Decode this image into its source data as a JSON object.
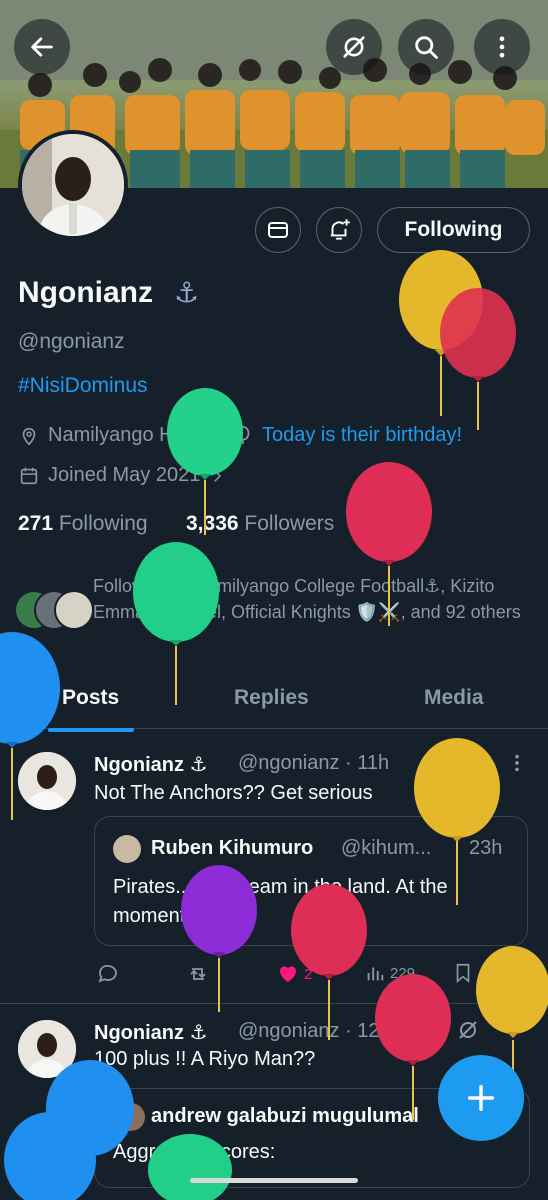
{
  "profile": {
    "name": "Ngonianz",
    "anchor_glyph": "⚓",
    "handle": "@ngonianz",
    "bio_hashtag": "#NisiDominus",
    "location": "Namilyango Hill",
    "birthday": "Today is their birthday!",
    "joined": "Joined May 2021",
    "following_count": "271",
    "following_label": "Following",
    "followers_count": "3,336",
    "followers_label": "Followers",
    "followed_by": "Followed by Namilyango College Football⚓, Kizito Emmanuel Noel, Official Knights 🛡️⚔️, and 92 others"
  },
  "buttons": {
    "follow_state": "Following"
  },
  "tabs": [
    {
      "label": "Posts",
      "active": true
    },
    {
      "label": "Replies",
      "active": false
    },
    {
      "label": "Media",
      "active": false
    }
  ],
  "posts": [
    {
      "author": "Ngonianz ⚓",
      "handle_time": "@ngonianz · 11h",
      "text": "Not The Anchors?? Get serious",
      "quote": {
        "author": "Ruben Kihumuro",
        "handle": "@kihum...",
        "time": "23h",
        "text": "Pirates... Best team in the land. At the moment."
      },
      "likes": "2",
      "views": "229"
    },
    {
      "author": "Ngonianz ⚓",
      "handle_time": "@ngonianz · 12h",
      "text": "100 plus !! A Riyo Man??",
      "quote": {
        "author": "andrew galabuzi mugulumal",
        "text": "Aggregate scores:"
      }
    }
  ],
  "colors": {
    "background": "#15202b",
    "accent": "#1d9bf0",
    "muted": "#8b98a5",
    "like": "#f91880"
  },
  "icons": [
    "back-arrow-icon",
    "grok-icon",
    "search-icon",
    "more-vertical-icon",
    "mail-icon",
    "bell-plus-icon",
    "location-icon",
    "balloon-icon",
    "calendar-icon",
    "reply-icon",
    "retweet-icon",
    "heart-icon",
    "views-icon",
    "bookmark-icon",
    "share-icon",
    "compose-plus-icon"
  ]
}
